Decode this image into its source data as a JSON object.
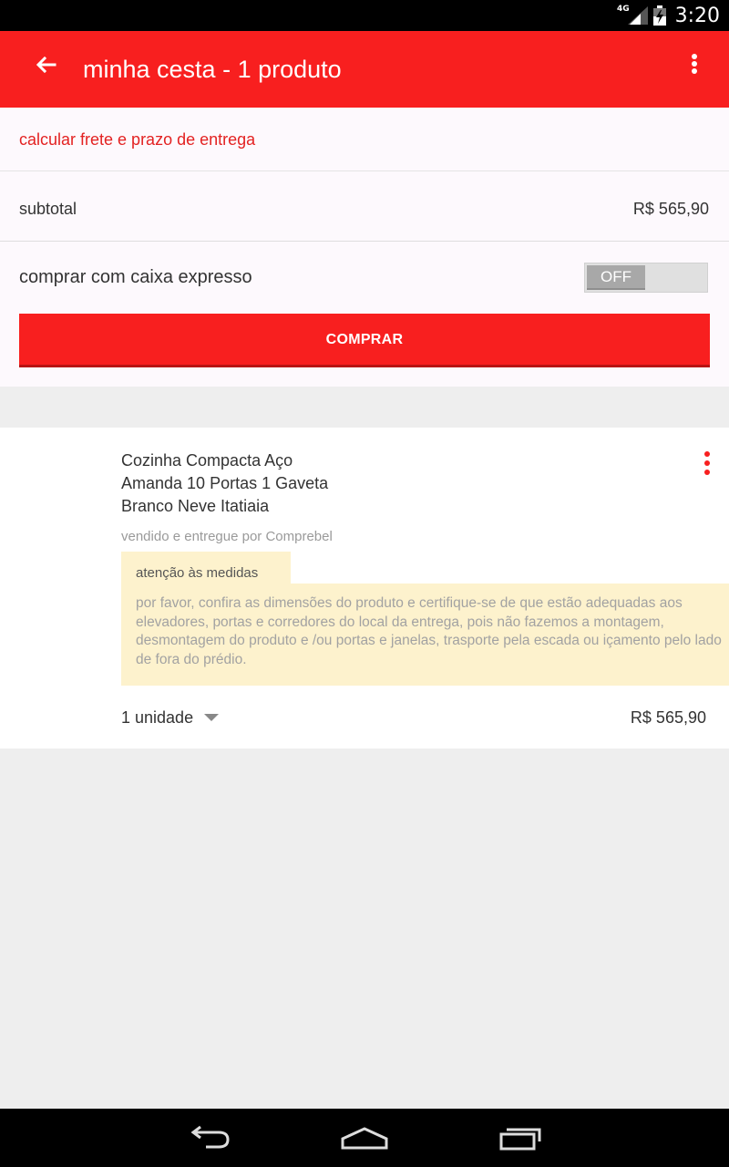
{
  "status_bar": {
    "network_label": "4G",
    "time": "3:20"
  },
  "app_bar": {
    "title": "minha cesta - 1 produto",
    "back_icon": "arrow-back-icon",
    "menu_icon": "more-vert-icon",
    "color": "#f81f1f"
  },
  "cart_summary": {
    "freight_link": "calcular frete e prazo de entrega",
    "subtotal_label": "subtotal",
    "subtotal_value": "R$ 565,90",
    "express_label": "comprar com caixa expresso",
    "express_toggle": {
      "state": "OFF",
      "checked": false
    },
    "buy_button": "COMPRAR"
  },
  "product": {
    "name_lines": [
      "Cozinha Compacta Aço",
      "Amanda 10 Portas 1 Gaveta",
      "Branco Neve Itatiaia"
    ],
    "seller": "vendido e entregue por Comprebel",
    "warning": {
      "title": "atenção às medidas",
      "text": "por favor, confira as dimensões do produto e certifique-se de que estão adequadas aos elevadores, portas e corredores do local da entrega, pois não fazemos a montagem, desmontagem do produto e /ou portas e janelas, trasporte pela escada ou içamento pelo lado de fora do prédio."
    },
    "quantity": "1 unidade",
    "price": "R$ 565,90"
  },
  "nav_bar": {
    "icons": [
      "back-icon",
      "home-icon",
      "recent-apps-icon"
    ]
  }
}
